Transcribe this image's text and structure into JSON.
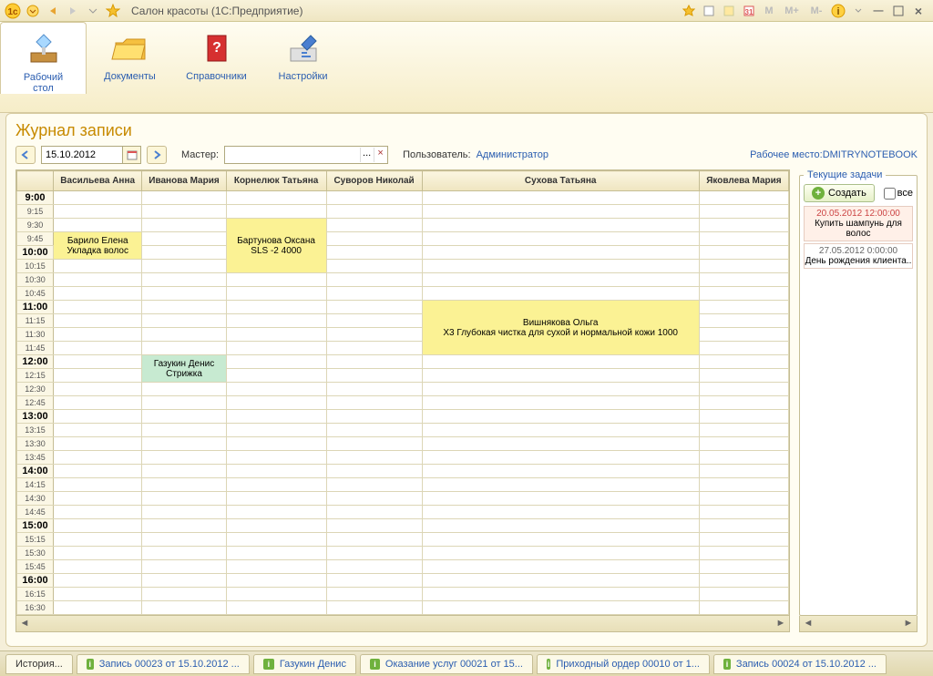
{
  "window_title": "Салон красоты  (1С:Предприятие)",
  "ribbon": [
    {
      "label": "Рабочий\nстол"
    },
    {
      "label": "Документы"
    },
    {
      "label": "Справочники"
    },
    {
      "label": "Настройки"
    }
  ],
  "view_title": "Журнал записи",
  "date_value": "15.10.2012",
  "master_label": "Мастер:",
  "user_label": "Пользователь:",
  "user_value": "Администратор",
  "workplace_label": "Рабочее место:",
  "workplace_value": "DMITRYNOTEBOOK",
  "columns": [
    "Васильева Анна",
    "Иванова Мария",
    "Корнелюк Татьяна",
    "Суворов Николай",
    "Сухова Татьяна",
    "Яковлева Мария"
  ],
  "time_start_hour": 9,
  "time_end_hour": 17,
  "appointments": [
    {
      "col": 0,
      "row_start": 3,
      "row_span": 2,
      "cls": "appt",
      "line1": "Барило Елена",
      "line2": "Укладка волос"
    },
    {
      "col": 2,
      "row_start": 2,
      "row_span": 4,
      "cls": "appt",
      "line1": "Бартунова Оксана",
      "line2": "SLS -2 4000"
    },
    {
      "col": 4,
      "row_start": 8,
      "row_span": 4,
      "cls": "appt",
      "line1": "Вишнякова Ольга",
      "line2": "X3 Глубокая чистка для сухой и нормальной кожи 1000"
    },
    {
      "col": 1,
      "row_start": 12,
      "row_span": 2,
      "cls": "appt-green",
      "line1": "Газукин Денис",
      "line2": "Стрижка"
    }
  ],
  "tasks": {
    "legend": "Текущие задачи",
    "create": "Создать",
    "all": "все",
    "items": [
      {
        "dt": "20.05.2012 12:00:00",
        "txt": "Купить шампунь для волос",
        "sel": true
      },
      {
        "dt": "27.05.2012 0:00:00",
        "txt": "День рождения клиента..",
        "sel": false
      }
    ]
  },
  "taskbar": [
    {
      "label": "История...",
      "ico": false,
      "history": true
    },
    {
      "label": "Запись 00023 от 15.10.2012 ...",
      "ico": true
    },
    {
      "label": "Газукин Денис",
      "ico": true
    },
    {
      "label": "Оказание услуг 00021 от 15...",
      "ico": true
    },
    {
      "label": "Приходный ордер 00010 от 1...",
      "ico": true
    },
    {
      "label": "Запись 00024 от 15.10.2012 ...",
      "ico": true
    }
  ],
  "titlebar_mem": {
    "m": "M",
    "mp": "M+",
    "mm": "M-"
  }
}
